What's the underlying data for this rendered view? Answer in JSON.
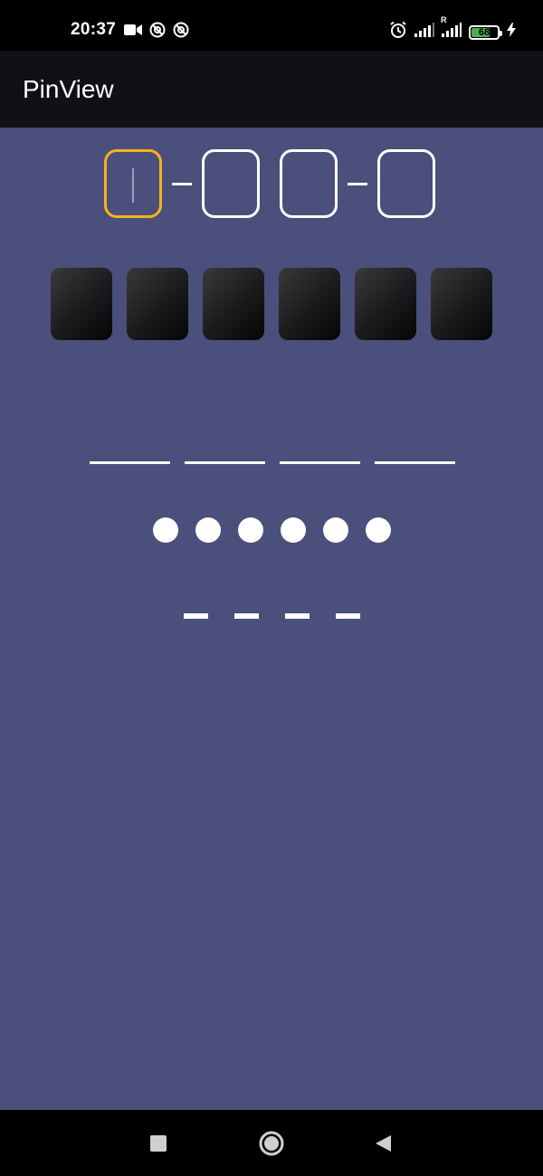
{
  "status_bar": {
    "time": "20:37",
    "battery_level": "68",
    "signal_roaming_label": "R",
    "icons": [
      "video-camera-icon",
      "no-data-icon",
      "no-data-icon",
      "alarm-icon",
      "signal-icon",
      "signal-roaming-icon",
      "battery-icon",
      "charging-bolt-icon"
    ]
  },
  "app_bar": {
    "title": "PinView"
  },
  "pin_views": [
    {
      "style": "outlined-with-dashes",
      "fields": 4,
      "active_index": 0,
      "active_color": "#f5b21a"
    },
    {
      "style": "dark-gradient-boxes",
      "fields": 6
    },
    {
      "style": "underline",
      "fields": 4
    },
    {
      "style": "filled-dots",
      "fields": 6
    },
    {
      "style": "short-dashes",
      "fields": 4
    }
  ],
  "nav_bar": {
    "buttons": [
      "recents-button",
      "home-button",
      "back-button"
    ]
  },
  "colors": {
    "background": "#4a4f7b",
    "app_bar": "#111015",
    "accent": "#f5b21a"
  }
}
